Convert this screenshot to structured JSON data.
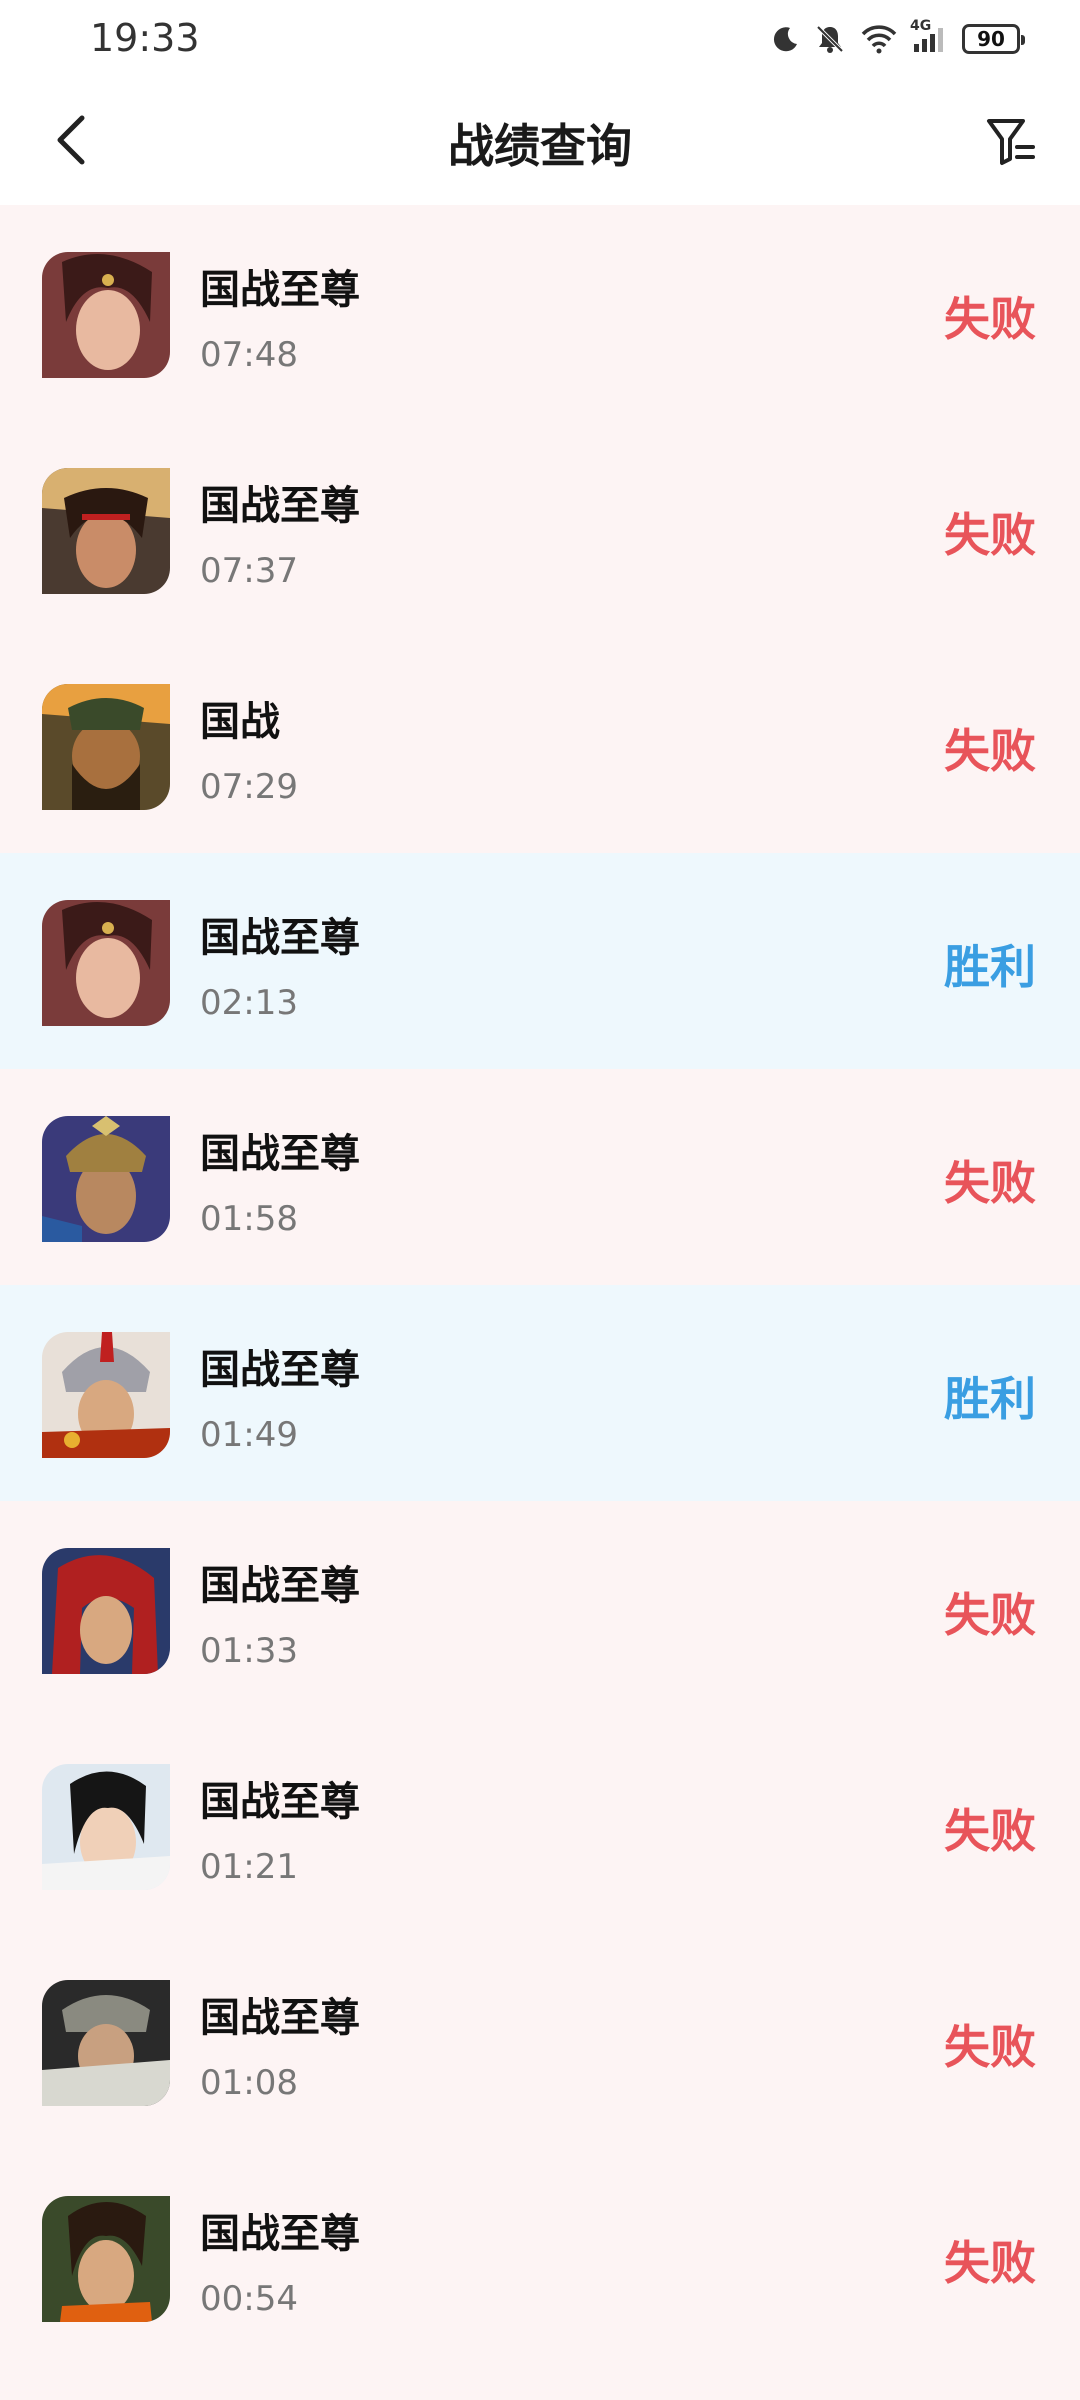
{
  "status_bar": {
    "time": "19:33",
    "network": "4G",
    "battery": "90",
    "icons": [
      "moon-icon",
      "bell-off-icon",
      "wifi-icon",
      "signal-icon",
      "battery-icon"
    ]
  },
  "header": {
    "title": "战绩查询",
    "back_icon": "chevron-left-icon",
    "filter_icon": "filter-icon"
  },
  "colors": {
    "lose_text": "#e8545a",
    "win_text": "#3a9ee2",
    "lose_bg": "#fdf4f4",
    "win_bg": "#eef8fd"
  },
  "matches": [
    {
      "mode": "国战至尊",
      "time": "07:48",
      "result": "失败",
      "outcome": "lose"
    },
    {
      "mode": "国战至尊",
      "time": "07:37",
      "result": "失败",
      "outcome": "lose"
    },
    {
      "mode": "国战",
      "time": "07:29",
      "result": "失败",
      "outcome": "lose"
    },
    {
      "mode": "国战至尊",
      "time": "02:13",
      "result": "胜利",
      "outcome": "win"
    },
    {
      "mode": "国战至尊",
      "time": "01:58",
      "result": "失败",
      "outcome": "lose"
    },
    {
      "mode": "国战至尊",
      "time": "01:49",
      "result": "胜利",
      "outcome": "win"
    },
    {
      "mode": "国战至尊",
      "time": "01:33",
      "result": "失败",
      "outcome": "lose"
    },
    {
      "mode": "国战至尊",
      "time": "01:21",
      "result": "失败",
      "outcome": "lose"
    },
    {
      "mode": "国战至尊",
      "time": "01:08",
      "result": "失败",
      "outcome": "lose"
    },
    {
      "mode": "国战至尊",
      "time": "00:54",
      "result": "失败",
      "outcome": "lose"
    }
  ]
}
